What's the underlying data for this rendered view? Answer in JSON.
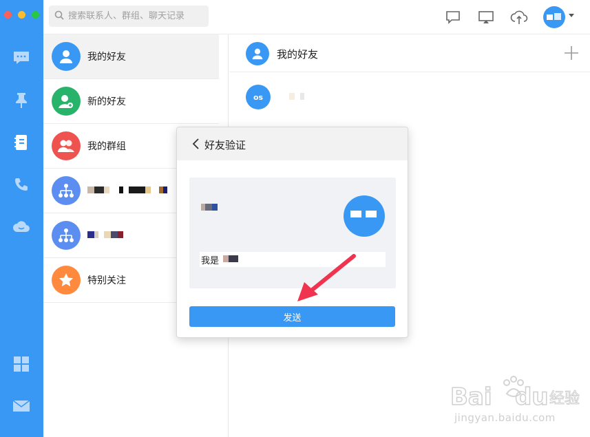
{
  "search": {
    "placeholder": "搜索联系人、群组、聊天记录"
  },
  "nav": {
    "items": [
      {
        "name": "message-icon"
      },
      {
        "name": "pin-icon"
      },
      {
        "name": "contacts-book-icon"
      },
      {
        "name": "phone-icon"
      },
      {
        "name": "cloud-icon"
      },
      {
        "name": "apps-grid-icon"
      },
      {
        "name": "mail-icon"
      }
    ]
  },
  "contacts": {
    "items": [
      {
        "label": "我的好友",
        "color": "#3a98f5",
        "icon": "user-icon",
        "active": true
      },
      {
        "label": "新的好友",
        "color": "#27b36a",
        "icon": "add-user-icon"
      },
      {
        "label": "我的群组",
        "color": "#ef5350",
        "icon": "group-icon"
      },
      {
        "label": "",
        "color": "#5b8ef0",
        "icon": "org-chart-icon"
      },
      {
        "label": "",
        "color": "#5b8ef0",
        "icon": "org-chart-icon"
      },
      {
        "label": "特别关注",
        "color": "#ff8a3d",
        "icon": "star-icon"
      }
    ]
  },
  "pane": {
    "title": "我的好友",
    "friend_avatar_text": "os"
  },
  "dialog": {
    "title": "好友验证",
    "message_prefix": "我是",
    "send_label": "发送"
  },
  "watermark": {
    "text": "jingyan.baidu.com"
  },
  "colors": {
    "accent": "#3a98f5",
    "arrow": "#f0344f"
  }
}
